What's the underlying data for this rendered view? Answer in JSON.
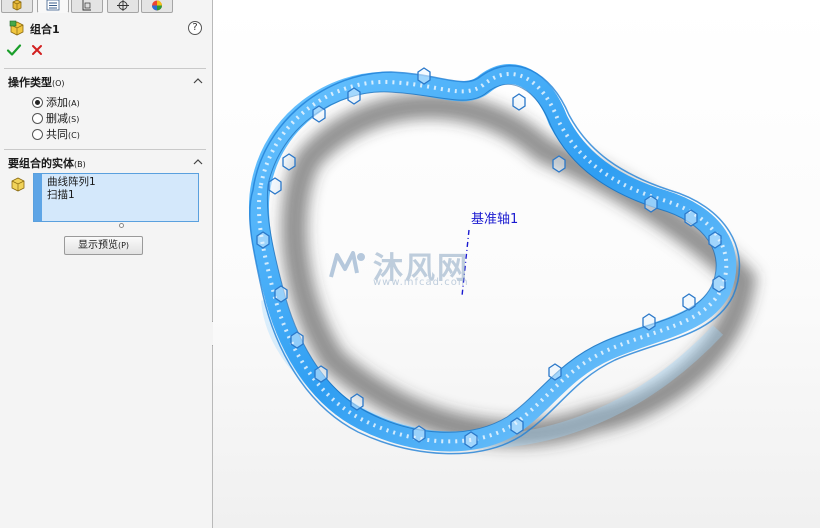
{
  "panel": {
    "tabs": [
      {
        "name": "feature-manager",
        "icon": "feature-tree-icon"
      },
      {
        "name": "property-manager",
        "icon": "property-manager-icon"
      },
      {
        "name": "configuration-manager",
        "icon": "configuration-icon"
      },
      {
        "name": "dimxpert-manager",
        "icon": "dimxpert-icon"
      },
      {
        "name": "display-manager",
        "icon": "appearance-icon"
      }
    ],
    "title": "组合1",
    "help_glyph": "?",
    "ok_icon": "check-icon",
    "cancel_icon": "close-icon",
    "operation": {
      "heading": "操作类型",
      "heading_key": "(O)",
      "options": [
        {
          "label": "添加",
          "key": "(A)",
          "selected": true
        },
        {
          "label": "删减",
          "key": "(S)",
          "selected": false
        },
        {
          "label": "共同",
          "key": "(C)",
          "selected": false
        }
      ]
    },
    "bodies": {
      "heading": "要组合的实体",
      "heading_key": "(B)",
      "items": [
        "曲线阵列1",
        "扫描1"
      ]
    },
    "preview_button": {
      "label": "显示预览",
      "key": "(P)"
    }
  },
  "viewport": {
    "axis_label": "基准轴1",
    "watermark_text": "沐风网",
    "watermark_url": "www.mfcad.com"
  },
  "colors": {
    "accent": "#5ea5e6",
    "selection_fill": "#d4e8fb",
    "ok_green": "#1a9e2a",
    "cancel_red": "#d21f1f",
    "part_blue": "#3fa9f5",
    "axis_blue": "#1a1ad0"
  }
}
